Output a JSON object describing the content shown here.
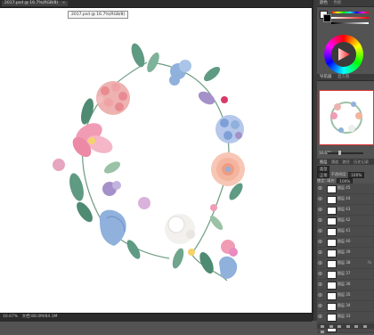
{
  "document": {
    "tab_title": "2017.psd @ 16.7%(RGB/8)",
    "tab_close": "×",
    "tooltip": "2017.psd @ 16.7%(RGB/8)"
  },
  "status": {
    "zoom": "16.67%",
    "doc_info": "文档:88.0M/84.3M"
  },
  "panels": {
    "color": {
      "tab": "颜色",
      "other_tab": "色板",
      "foreground": "#ffffff",
      "background": "#000000"
    },
    "navigator": {
      "tab": "导航器",
      "other_tab": "直方图",
      "zoom": "16.67%"
    },
    "layers": {
      "tabs": [
        "图层",
        "通道",
        "路径",
        "历史记录"
      ],
      "kind": "类型",
      "blend_mode": "正常",
      "opacity_label": "不透明度:",
      "opacity": "100%",
      "lock_label": "锁定:",
      "fill_label": "填充:",
      "fill": "100%",
      "rows": [
        {
          "name": "图层 45",
          "fx": ""
        },
        {
          "name": "图层 44",
          "fx": ""
        },
        {
          "name": "图层 43",
          "fx": ""
        },
        {
          "name": "图层 42",
          "fx": ""
        },
        {
          "name": "图层 41",
          "fx": ""
        },
        {
          "name": "图层 40",
          "fx": ""
        },
        {
          "name": "图层 39",
          "fx": ""
        },
        {
          "name": "图层 38",
          "fx": "fx"
        },
        {
          "name": "图层 37",
          "fx": ""
        },
        {
          "name": "图层 36",
          "fx": ""
        },
        {
          "name": "图层 35",
          "fx": ""
        },
        {
          "name": "图层 34",
          "fx": ""
        },
        {
          "name": "图层 33",
          "fx": ""
        },
        {
          "name": "图层 32",
          "fx": ""
        }
      ]
    }
  },
  "colors": {
    "pink": "#f19cb5",
    "rose": "#e98a91",
    "blue": "#8fb1dc",
    "purple": "#a591c9",
    "leaf": "#5f9a83",
    "leaf_light": "#9bc2a6",
    "peach": "#f4b59f",
    "yellow": "#f5d36a"
  }
}
